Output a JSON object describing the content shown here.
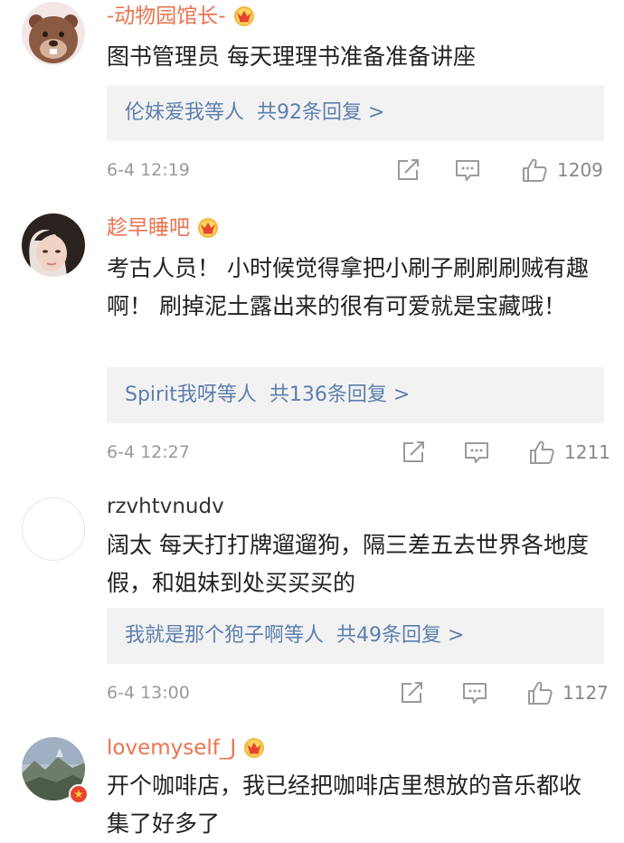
{
  "comments": [
    {
      "username": "-动物园馆长-",
      "vip": true,
      "avatar": "beaver-cartoon-avatar",
      "text": "图书管理员 每天理理书准备准备讲座",
      "reply_users": "伦妹爱我等人",
      "reply_count": "共92条回复 >",
      "time": "6-4 12:19",
      "likes": "1209"
    },
    {
      "username": "趁早睡吧",
      "vip": true,
      "avatar": "girl-photo-avatar",
      "text": "考古人员！ 小时候觉得拿把小刷子刷刷刷贼有趣啊！ 刷掉泥土露出来的很有可爱就是宝藏哦！",
      "reply_users": "Spirit我呀等人",
      "reply_count": "共136条回复 >",
      "time": "6-4 12:27",
      "likes": "1211"
    },
    {
      "username": "rzvhtvnudv",
      "vip": false,
      "avatar": "blank-avatar",
      "text": "阔太 每天打打牌遛遛狗，隔三差五去世界各地度假，和姐妹到处买买买的",
      "reply_users": "我就是那个狍子啊等人",
      "reply_count": "共49条回复 >",
      "time": "6-4 13:00",
      "likes": "1127"
    },
    {
      "username": "lovemyself_J",
      "vip": true,
      "avatar": "landscape-photo-avatar",
      "text": "开个咖啡店，我已经把咖啡店里想放的音乐都收集了好多了"
    }
  ],
  "colors": {
    "vip_name": "#eb7350",
    "reply_link": "#5d7fae",
    "reply_bg": "#f2f2f2",
    "meta_text": "#9a9a9a"
  },
  "icons": {
    "share": "share-icon",
    "comment": "comment-icon",
    "like": "thumbs-up-icon",
    "vip": "vip-crown-icon"
  }
}
